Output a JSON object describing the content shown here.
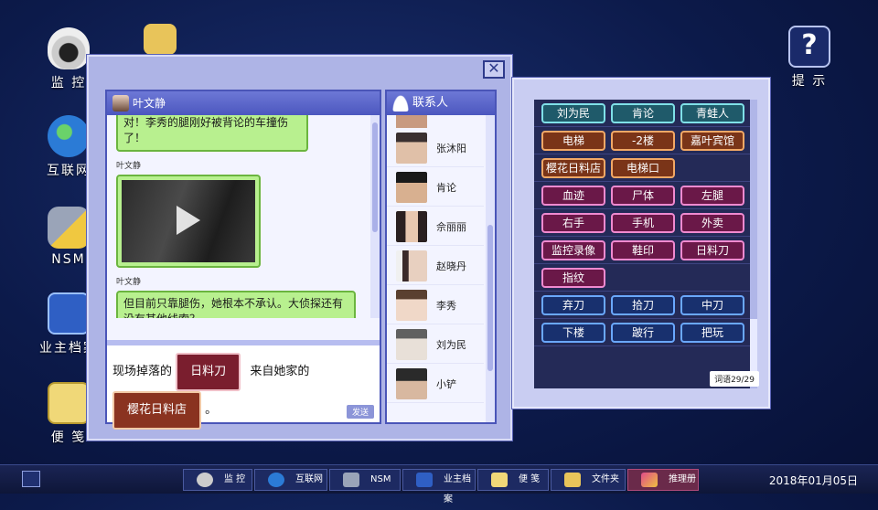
{
  "desktop": {
    "icons": [
      {
        "label": "监 控",
        "icon": "camera-icon"
      },
      {
        "label": "互联网",
        "icon": "globe-icon"
      },
      {
        "label": "NSM",
        "icon": "chat-icon"
      },
      {
        "label": "业主档案",
        "icon": "file-icon"
      },
      {
        "label": "便 笺",
        "icon": "note-icon"
      },
      {
        "label": "提 示",
        "icon": "help-icon"
      }
    ]
  },
  "chat": {
    "contact_name": "叶文静",
    "messages": [
      {
        "sender": "",
        "text": "对！李秀的腿刚好被背论的车撞伤了！"
      },
      {
        "sender": "叶文静",
        "type": "video"
      },
      {
        "sender": "叶文静",
        "text": "但目前只靠腿伤，她根本不承认。大侦探还有没有其他线索？"
      }
    ],
    "compose": {
      "part1": "现场掉落的",
      "slot1": "日料刀",
      "part2": "来自她家的",
      "slot2": "樱花日料店",
      "part3": "。",
      "send_label": "发送"
    }
  },
  "contacts": {
    "title": "联系人",
    "items": [
      "张沐阳",
      "肯论",
      "佘丽丽",
      "赵晓丹",
      "李秀",
      "刘为民",
      "小铲"
    ]
  },
  "clues": {
    "rows": [
      [
        {
          "label": "刘为民",
          "color": "teal"
        },
        {
          "label": "肯论",
          "color": "teal"
        },
        {
          "label": "青蛙人",
          "color": "teal"
        }
      ],
      [
        {
          "label": "电梯",
          "color": "orange"
        },
        {
          "label": "-2楼",
          "color": "orange"
        },
        {
          "label": "嘉叶宾馆",
          "color": "orange"
        }
      ],
      [
        {
          "label": "樱花日料店",
          "color": "orange"
        },
        {
          "label": "电梯口",
          "color": "orange"
        }
      ],
      [
        {
          "label": "血迹",
          "color": "pink"
        },
        {
          "label": "尸体",
          "color": "pink"
        },
        {
          "label": "左腿",
          "color": "pink"
        }
      ],
      [
        {
          "label": "右手",
          "color": "pink"
        },
        {
          "label": "手机",
          "color": "pink"
        },
        {
          "label": "外卖",
          "color": "pink"
        }
      ],
      [
        {
          "label": "监控录像",
          "color": "pink"
        },
        {
          "label": "鞋印",
          "color": "pink"
        },
        {
          "label": "日料刀",
          "color": "pink"
        }
      ],
      [
        {
          "label": "指纹",
          "color": "pink"
        }
      ],
      [
        {
          "label": "弃刀",
          "color": "blue"
        },
        {
          "label": "拾刀",
          "color": "blue"
        },
        {
          "label": "中刀",
          "color": "blue"
        }
      ],
      [
        {
          "label": "下楼",
          "color": "blue"
        },
        {
          "label": "跛行",
          "color": "blue"
        },
        {
          "label": "把玩",
          "color": "blue"
        }
      ]
    ],
    "counter": "词语29/29"
  },
  "taskbar": {
    "items": [
      "监 控",
      "互联网",
      "NSM",
      "业主档案",
      "便 笺",
      "文件夹",
      "推理册"
    ],
    "active": "推理册",
    "clock": "2018年01月05日"
  }
}
